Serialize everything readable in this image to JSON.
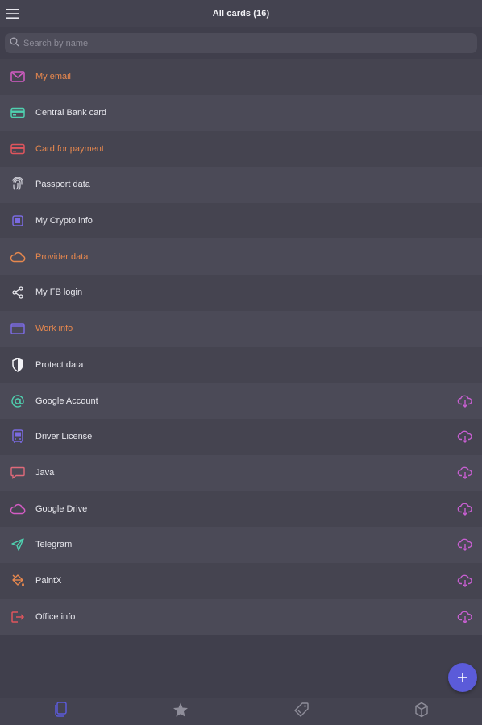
{
  "header": {
    "title": "All cards (16)"
  },
  "search": {
    "placeholder": "Search by name"
  },
  "colors": {
    "accent": "#5b5bd9",
    "orange": "#e8884e",
    "teal": "#4fd1b0",
    "red": "#e0555d",
    "purple": "#7a6ae0",
    "pink": "#d45cc4",
    "coral": "#e06a7a",
    "cloud": "#c85fd2"
  },
  "cards": [
    {
      "label": "My email",
      "icon": "mail-icon",
      "color": "#d45cc4",
      "label_color": "#e8884e",
      "cloud": false
    },
    {
      "label": "Central Bank card",
      "icon": "credit-card-icon",
      "color": "#4fd1b0",
      "label_color": "#e8e8ee",
      "cloud": false
    },
    {
      "label": "Card for payment",
      "icon": "credit-card-icon",
      "color": "#e0555d",
      "label_color": "#e8884e",
      "cloud": false
    },
    {
      "label": "Passport data",
      "icon": "fingerprint-icon",
      "color": "#c9c9d2",
      "label_color": "#e8e8ee",
      "cloud": false
    },
    {
      "label": "My Crypto info",
      "icon": "chip-icon",
      "color": "#7a6ae0",
      "label_color": "#e8e8ee",
      "cloud": false
    },
    {
      "label": "Provider data",
      "icon": "cloud-icon",
      "color": "#e8884e",
      "label_color": "#e8884e",
      "cloud": false
    },
    {
      "label": "My FB login",
      "icon": "share-icon",
      "color": "#e8e8ee",
      "label_color": "#e8e8ee",
      "cloud": false
    },
    {
      "label": "Work info",
      "icon": "window-icon",
      "color": "#7a6ae0",
      "label_color": "#e8884e",
      "cloud": false
    },
    {
      "label": "Protect data",
      "icon": "shield-icon",
      "color": "#f2f2f6",
      "label_color": "#e8e8ee",
      "cloud": false
    },
    {
      "label": "Google Account",
      "icon": "at-sign-icon",
      "color": "#4fd1b0",
      "label_color": "#e8e8ee",
      "cloud": true
    },
    {
      "label": "Driver License",
      "icon": "bus-icon",
      "color": "#7a6ae0",
      "label_color": "#e8e8ee",
      "cloud": true
    },
    {
      "label": "Java",
      "icon": "chat-bubble-icon",
      "color": "#e06a7a",
      "label_color": "#e8e8ee",
      "cloud": true
    },
    {
      "label": "Google Drive",
      "icon": "cloud-icon",
      "color": "#d45cc4",
      "label_color": "#e8e8ee",
      "cloud": true
    },
    {
      "label": "Telegram",
      "icon": "send-icon",
      "color": "#4fd1b0",
      "label_color": "#e8e8ee",
      "cloud": true
    },
    {
      "label": "PaintX",
      "icon": "paint-bucket-icon",
      "color": "#e8884e",
      "label_color": "#e8e8ee",
      "cloud": true
    },
    {
      "label": "Office info",
      "icon": "exit-icon",
      "color": "#e0555d",
      "label_color": "#e8e8ee",
      "cloud": true
    }
  ],
  "tabs": [
    {
      "name": "cards-icon",
      "active": true
    },
    {
      "name": "star-icon",
      "active": false
    },
    {
      "name": "tag-icon",
      "active": false
    },
    {
      "name": "box-icon",
      "active": false
    }
  ]
}
